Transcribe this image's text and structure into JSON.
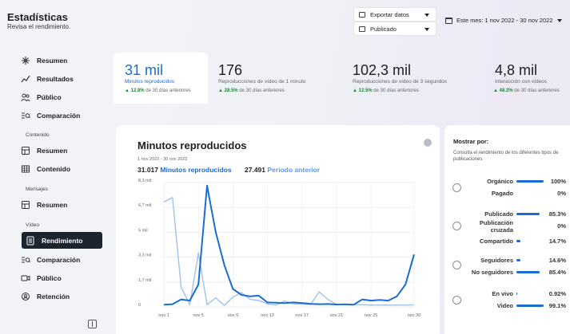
{
  "header": {
    "title": "Estadísticas",
    "subtitle": "Revisa el rendimiento."
  },
  "controls": {
    "export_label": "Exportar datos",
    "status_label": "Publicado",
    "date_range": "Este mes: 1 nov 2022 - 30 nov 2022"
  },
  "sidebar": {
    "top_items": [
      {
        "label": "Resumen",
        "icon": "sparkle-icon"
      },
      {
        "label": "Resultados",
        "icon": "trend-icon"
      },
      {
        "label": "Público",
        "icon": "people-icon"
      },
      {
        "label": "Comparación",
        "icon": "compare-icon"
      }
    ],
    "section_content": "Contenido",
    "content_items": [
      {
        "label": "Resumen",
        "icon": "grid-icon"
      },
      {
        "label": "Contenido",
        "icon": "table-icon"
      }
    ],
    "section_messages": "Mensajes",
    "message_items": [
      {
        "label": "Resumen",
        "icon": "grid-icon"
      }
    ],
    "section_video": "Vídeo",
    "video_items": [
      {
        "label": "Rendimiento",
        "icon": "document-icon",
        "active": true
      },
      {
        "label": "Comparación",
        "icon": "compare-icon"
      },
      {
        "label": "Público",
        "icon": "camera-icon"
      },
      {
        "label": "Retención",
        "icon": "retention-icon"
      }
    ]
  },
  "metrics": [
    {
      "value": "31 mil",
      "label": "Minutos reproducidos",
      "change": "12.8%",
      "change_suffix": "de 30 días anteriores",
      "selected": true
    },
    {
      "value": "176",
      "label": "Reproducciones de vídeo de 1 minuto",
      "change": "28.5%",
      "change_suffix": "de 30 días anteriores"
    },
    {
      "value": "102,3 mil",
      "label": "Reproducciones de vídeo de 3 segundos",
      "change": "12.5%",
      "change_suffix": "de 30 días anteriores"
    },
    {
      "value": "4,8 mil",
      "label": "Interacción con vídeos",
      "change": "48.2%",
      "change_suffix": "de 30 días anteriores"
    }
  ],
  "main_chart": {
    "title": "Minutos reproducidos",
    "date_range": "1 nov 2022 - 30 nov 2022",
    "current_value": "31.017",
    "current_label": "Minutos reproducidos",
    "previous_value": "27.491",
    "previous_label": "Período anterior"
  },
  "chart_data": {
    "type": "line",
    "title": "Minutos reproducidos",
    "x_tick_labels": [
      "nov 1",
      "nov 5",
      "nov 9",
      "nov 13",
      "nov 17",
      "nov 21",
      "nov 25",
      "nov 30"
    ],
    "y_tick_labels": [
      "0",
      "1,7 mil",
      "3,3 mil",
      "5 mil",
      "6,7 mil",
      "8,3 mil"
    ],
    "x_days": [
      1,
      5,
      9,
      13,
      17,
      21,
      25,
      30
    ],
    "ylim": [
      0,
      8300
    ],
    "grid": true,
    "series": [
      {
        "name": "Minutos reproducidos",
        "color": "#1a6cd4",
        "x": [
          1,
          2,
          3,
          4,
          5,
          6,
          7,
          8,
          9,
          10,
          11,
          12,
          13,
          14,
          15,
          16,
          17,
          18,
          19,
          20,
          21,
          22,
          23,
          24,
          25,
          26,
          27,
          28,
          29,
          30
        ],
        "values": [
          150,
          180,
          500,
          420,
          1500,
          8100,
          5000,
          2800,
          1200,
          800,
          700,
          750,
          300,
          280,
          250,
          300,
          260,
          200,
          180,
          190,
          160,
          170,
          150,
          500,
          420,
          470,
          420,
          700,
          1500,
          3500
        ]
      },
      {
        "name": "Período anterior",
        "color": "#9fc1ee",
        "x": [
          1,
          2,
          3,
          4,
          5,
          6,
          7,
          8,
          9,
          10,
          11,
          12,
          13,
          14,
          15,
          16,
          17,
          18,
          19,
          20,
          21,
          22,
          23,
          24,
          25,
          26,
          27,
          28,
          29,
          30
        ],
        "values": [
          7000,
          7300,
          1300,
          150,
          3600,
          150,
          600,
          100,
          650,
          950,
          500,
          430,
          200,
          120,
          400,
          200,
          180,
          170,
          1000,
          500,
          160,
          170,
          150,
          150,
          120,
          120,
          120,
          120,
          120,
          140
        ]
      }
    ]
  },
  "filter_panel": {
    "title": "Mostrar por:",
    "description": "Consulta el rendimiento de los diferentes tipos de publicaciones",
    "groups": [
      {
        "rows": [
          {
            "label": "Orgánico",
            "pct": "100%",
            "value": 100
          },
          {
            "label": "Pagado",
            "pct": "0%",
            "value": 0
          }
        ]
      },
      {
        "rows": [
          {
            "label": "Publicado",
            "pct": "85.3%",
            "value": 85.3
          },
          {
            "label": "Publicación cruzada",
            "pct": "0%",
            "value": 0
          },
          {
            "label": "Compartido",
            "pct": "14.7%",
            "value": 14.7
          }
        ]
      },
      {
        "rows": [
          {
            "label": "Seguidores",
            "pct": "14.6%",
            "value": 14.6
          },
          {
            "label": "No seguidores",
            "pct": "85.4%",
            "value": 85.4
          }
        ]
      },
      {
        "rows": [
          {
            "label": "En vivo",
            "pct": "0.92%",
            "value": 0.92
          },
          {
            "label": "Video",
            "pct": "99.1%",
            "value": 99.1
          }
        ]
      }
    ]
  }
}
